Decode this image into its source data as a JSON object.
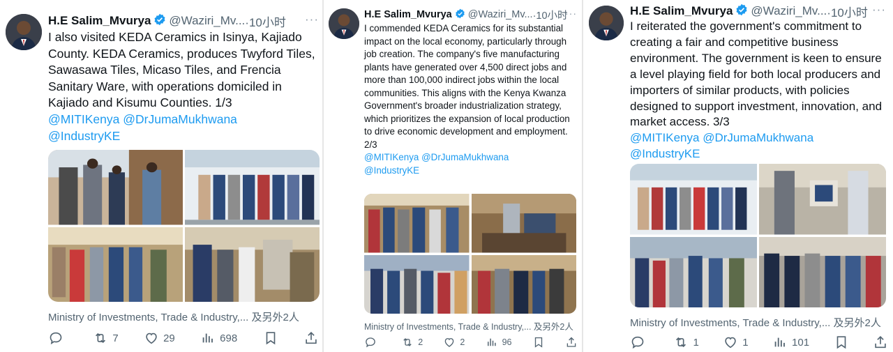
{
  "tweets": [
    {
      "author_name": "H.E Salim_Mvurya",
      "handle": "@Waziri_Mv...",
      "time": "·10小时",
      "text": "I also visited KEDA Ceramics in Isinya, Kajiado County. KEDA Ceramics, produces Twyford Tiles, Sawasawa Tiles, Micaso Tiles, and Frencia Sanitary Ware, with operations domiciled in Kajiado and Kisumu Counties. 1/3",
      "mentions": [
        "@MITIKenya",
        "@DrJumaMukhwana",
        "@IndustryKE"
      ],
      "tagged": "Ministry of Investments, Trade & Industry,... 及另外2人",
      "replies": "",
      "retweets": "7",
      "likes": "29",
      "views": "698"
    },
    {
      "author_name": "H.E Salim_Mvurya",
      "handle": "@Waziri_Mv...",
      "time": "·10小时",
      "text": "I commended KEDA Ceramics for its substantial impact on the local economy, particularly through job creation. The company's five manufacturing plants have generated over 4,500 direct jobs and more than 100,000 indirect jobs within the local communities. This aligns with the Kenya Kwanza Government's broader industrialization strategy, which prioritizes the expansion of local production to drive economic development and employment. 2/3",
      "mentions": [
        "@MITIKenya",
        "@DrJumaMukhwana",
        "@IndustryKE"
      ],
      "tagged": "Ministry of Investments, Trade & Industry,... 及另外2人",
      "replies": "",
      "retweets": "2",
      "likes": "2",
      "views": "96"
    },
    {
      "author_name": "H.E Salim_Mvurya",
      "handle": "@Waziri_Mv...",
      "time": "·10小时",
      "text": "I reiterated the government's commitment to creating a fair and competitive business environment. The government is keen to ensure a level playing field for both local producers and importers of similar products, with policies designed to support investment, innovation, and market access. 3/3",
      "mentions": [
        "@MITIKenya",
        "@DrJumaMukhwana",
        "@IndustryKE"
      ],
      "tagged": "Ministry of Investments, Trade & Industry,... 及另外2人",
      "replies": "",
      "retweets": "1",
      "likes": "1",
      "views": "101"
    }
  ],
  "icons": {
    "verified": "verified-badge-icon",
    "more": "more-options-icon",
    "reply": "reply-icon",
    "retweet": "retweet-icon",
    "like": "heart-icon",
    "views": "views-chart-icon",
    "bookmark": "bookmark-icon",
    "share": "share-icon"
  },
  "colors": {
    "verified": "#1d9bf0",
    "link": "#1d9bf0",
    "muted": "#536471",
    "text": "#0f1419"
  }
}
